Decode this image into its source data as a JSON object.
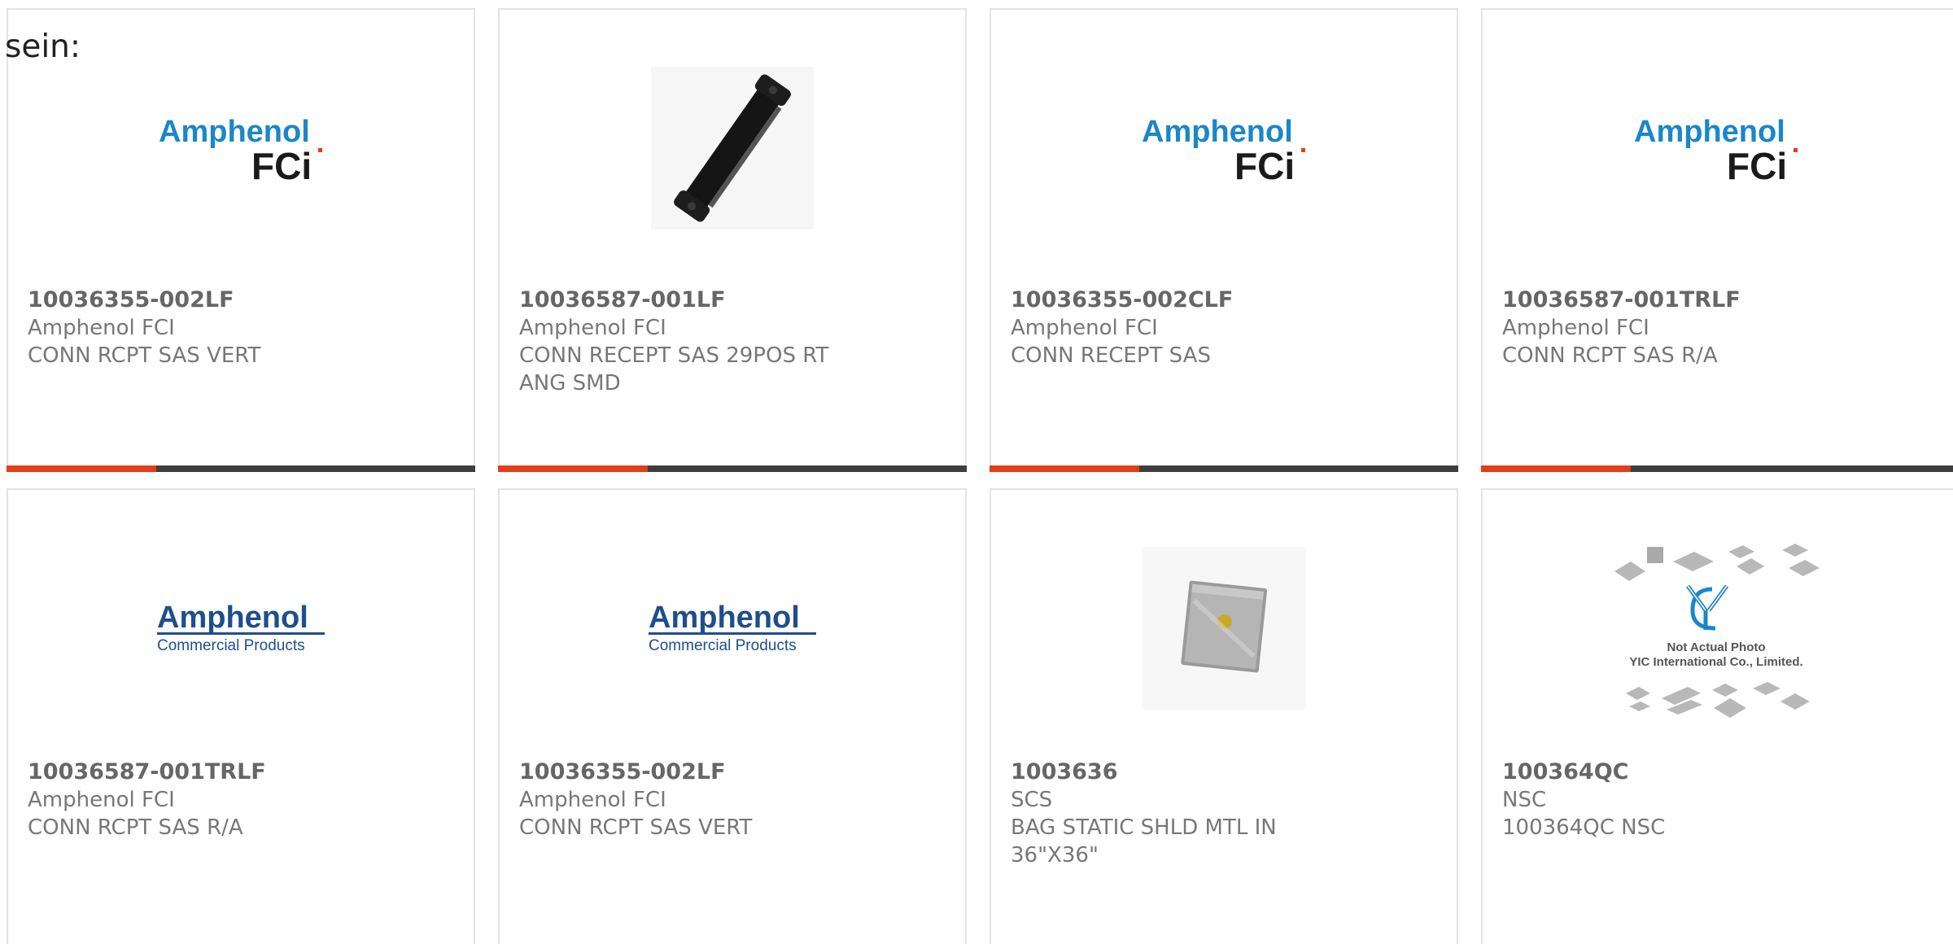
{
  "page": {
    "lead_text": "sein:"
  },
  "colors": {
    "accent": "#e43d17",
    "bar": "#3e3e3e",
    "brand_blue": "#1c86c8",
    "brand_navy": "#1f4e8c"
  },
  "products": [
    {
      "part_number": "10036355-002LF",
      "manufacturer": "Amphenol FCI",
      "description": "CONN RCPT SAS VERT",
      "image": "amphenol-fci-logo"
    },
    {
      "part_number": "10036587-001LF",
      "manufacturer": "Amphenol FCI",
      "description": "CONN RECEPT SAS 29POS RT ANG SMD",
      "image": "connector-photo"
    },
    {
      "part_number": "10036355-002CLF",
      "manufacturer": "Amphenol FCI",
      "description": "CONN RECEPT SAS",
      "image": "amphenol-fci-logo"
    },
    {
      "part_number": "10036587-001TRLF",
      "manufacturer": "Amphenol FCI",
      "description": "CONN RCPT SAS R/A",
      "image": "amphenol-fci-logo"
    },
    {
      "part_number": "10036587-001TRLF",
      "manufacturer": "Amphenol FCI",
      "description": "CONN RCPT SAS R/A",
      "image": "amphenol-commercial-logo"
    },
    {
      "part_number": "10036355-002LF",
      "manufacturer": "Amphenol FCI",
      "description": "CONN RCPT SAS VERT",
      "image": "amphenol-commercial-logo"
    },
    {
      "part_number": "1003636",
      "manufacturer": "SCS",
      "description": "BAG STATIC SHLD MTL IN 36\"X36\"",
      "image": "static-bag-photo"
    },
    {
      "part_number": "100364QC",
      "manufacturer": "NSC",
      "description": "100364QC NSC",
      "image": "yic-placeholder"
    }
  ],
  "logos": {
    "amphenol": "Amphenol",
    "fci": "FCi",
    "commercial": "Commercial Products",
    "yic_line1": "Not Actual Photo",
    "yic_line2": "YIC International Co., Limited.",
    "yic_mark": "YIC"
  }
}
